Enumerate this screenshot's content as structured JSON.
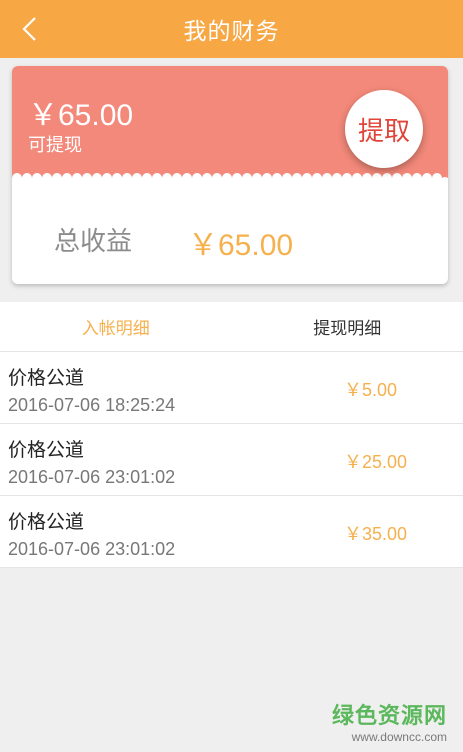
{
  "header": {
    "title": "我的财务",
    "back_icon": "chevron-left-icon"
  },
  "balance": {
    "amount": "￥65.00",
    "label": "可提现",
    "withdraw_label": "提取"
  },
  "total": {
    "label": "总收益",
    "amount": "￥65.00"
  },
  "tabs": [
    {
      "label": "入帐明细",
      "active": true
    },
    {
      "label": "提现明细",
      "active": false
    }
  ],
  "records": [
    {
      "name": "价格公道",
      "time": "2016-07-06 18:25:24",
      "amount": "￥5.00"
    },
    {
      "name": "价格公道",
      "time": "2016-07-06 23:01:02",
      "amount": "￥25.00"
    },
    {
      "name": "价格公道",
      "time": "2016-07-06 23:01:02",
      "amount": "￥35.00"
    }
  ],
  "watermark": {
    "main": "绿色资源网",
    "url": "www.downcc.com"
  },
  "colors": {
    "header": "#f8a745",
    "card_top": "#f3897a",
    "accent": "#f6b04e",
    "withdraw_text": "#e0453a"
  }
}
